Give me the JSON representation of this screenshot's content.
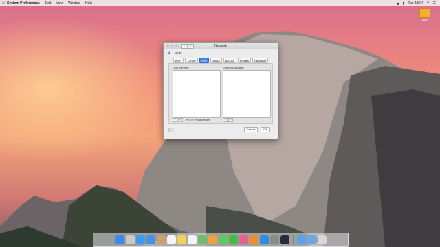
{
  "menubar": {
    "app_name": "System Preferences",
    "items": [
      "Edit",
      "View",
      "Window",
      "Help"
    ],
    "clock": "Tue 18:04"
  },
  "desktop": {
    "icon_label": "MBS"
  },
  "window": {
    "title": "Network",
    "interface_name": "Wi-Fi",
    "tabs": [
      "Wi-Fi",
      "TCP/IP",
      "DNS",
      "WINS",
      "802.1X",
      "Proxies",
      "Hardware"
    ],
    "active_tab": "DNS",
    "dns_servers_label": "DNS Servers:",
    "search_domains_label": "Search Domains:",
    "ipv_hint": "IPv4 or IPv6 addresses",
    "help_label": "?",
    "cancel_label": "Cancel",
    "ok_label": "OK"
  },
  "dock": {
    "apps": [
      "finder",
      "launchpad",
      "safari",
      "mail",
      "contacts",
      "calendar",
      "notes",
      "reminders",
      "maps",
      "photos",
      "messages",
      "facetime",
      "itunes",
      "ibooks",
      "app-store",
      "system-preferences",
      "quicktime",
      "downloads",
      "documents",
      "trash"
    ],
    "colors": [
      "#3d8be8",
      "#c9c9c9",
      "#3a9cf0",
      "#4a8fe0",
      "#c9a26a",
      "#f5f5f5",
      "#f2d15c",
      "#f5f5f5",
      "#6fbf6a",
      "#f0a040",
      "#5fc860",
      "#48b848",
      "#e5608a",
      "#f08a30",
      "#2f8ce6",
      "#8a8a8a",
      "#2a2a3a",
      "#5ba2e8",
      "#6aa8e4",
      "#d8d8d8"
    ]
  }
}
